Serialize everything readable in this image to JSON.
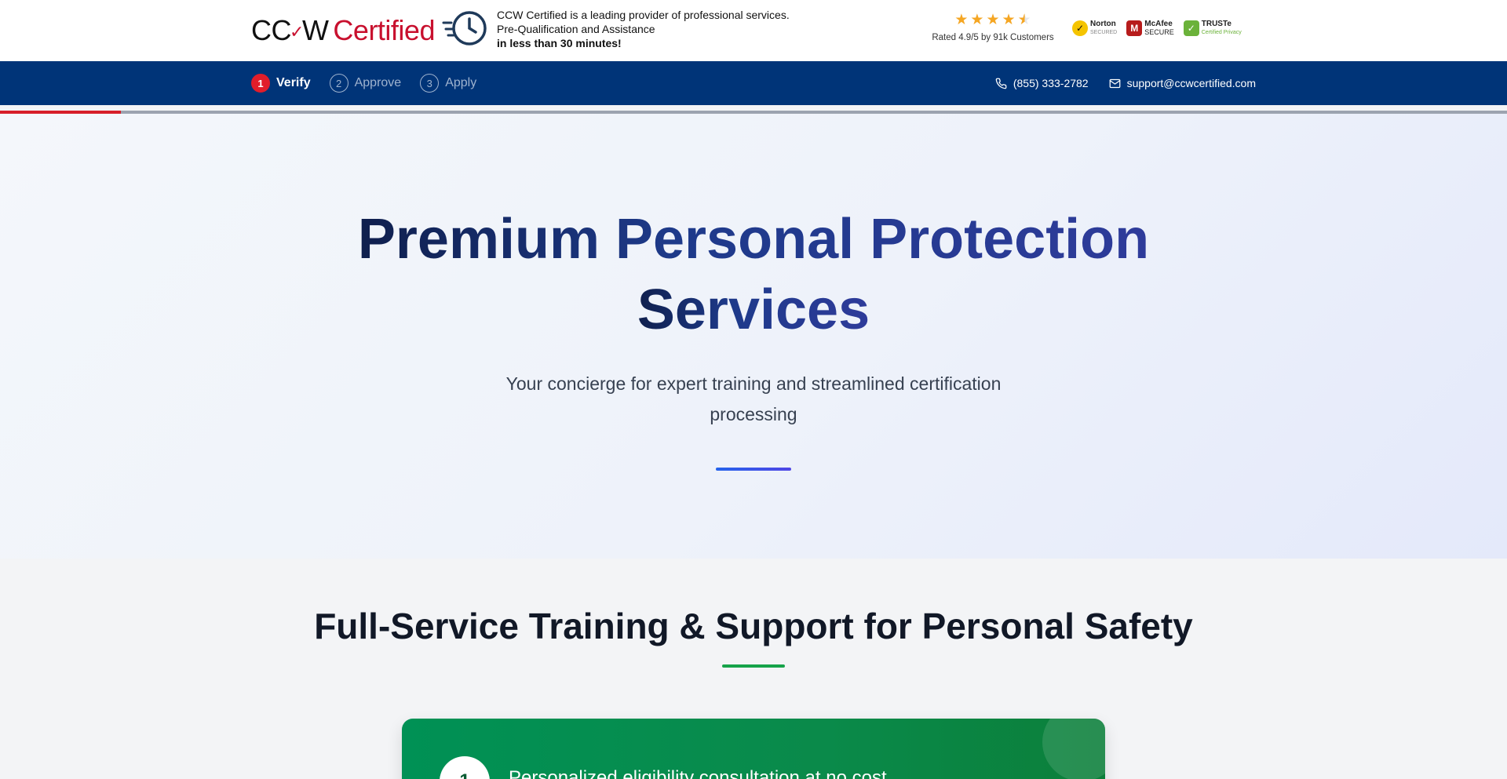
{
  "header": {
    "logo": {
      "part1_a": "CC",
      "part1_b": "W",
      "part2": "Certified"
    },
    "tagline": {
      "line1": "CCW Certified is a leading provider of professional services.",
      "line2": "Pre-Qualification and Assistance",
      "line3": "in less than 30 minutes!"
    },
    "rating": {
      "stars": 4.5,
      "text": "Rated 4.9/5 by 91k Customers"
    },
    "badges": [
      {
        "name": "Norton",
        "sub": "SECURED"
      },
      {
        "name": "McAfee",
        "sub": "SECURE"
      },
      {
        "name": "TRUSTe",
        "sub": "Certified Privacy"
      }
    ]
  },
  "nav": {
    "steps": [
      {
        "num": "1",
        "label": "Verify"
      },
      {
        "num": "2",
        "label": "Approve"
      },
      {
        "num": "3",
        "label": "Apply"
      }
    ],
    "phone": "(855) 333-2782",
    "email": "support@ccwcertified.com"
  },
  "progress": {
    "fraction": 0.08
  },
  "hero": {
    "title_line1": "Premium Personal Protection",
    "title_line2": "Services",
    "subtitle": "Your concierge for expert training and streamlined certification processing"
  },
  "services": {
    "title": "Full-Service Training & Support for Personal Safety",
    "items": [
      {
        "num": "1",
        "text": "Personalized eligibility consultation at no cost"
      }
    ]
  },
  "colors": {
    "navy": "#003478",
    "brand_red": "#c8102e",
    "star": "#f5a623",
    "card_green": "#009155"
  }
}
